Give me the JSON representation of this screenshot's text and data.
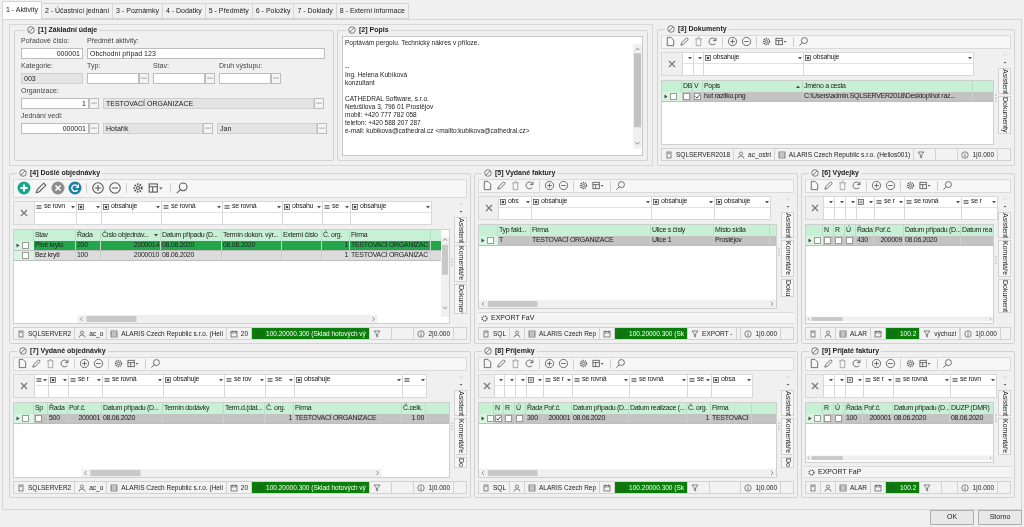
{
  "tabs": [
    {
      "label": "1 - Aktivity",
      "selected": true
    },
    {
      "label": "2 - Účastnící jednání",
      "selected": false
    },
    {
      "label": "3 - Poznámky",
      "selected": false
    },
    {
      "label": "4 - Dodatky",
      "selected": false
    },
    {
      "label": "5 - Předměty",
      "selected": false
    },
    {
      "label": "6 - Položky",
      "selected": false
    },
    {
      "label": "7 - Doklady",
      "selected": false
    },
    {
      "label": "8 - Externí informace",
      "selected": false
    }
  ],
  "basic": {
    "title": "[1] Základní údaje",
    "fields": [
      {
        "label": "Pořadové číslo:",
        "value": "000001",
        "kind": "number"
      },
      {
        "label": "Předmět aktivity:",
        "value": "Obchodní případ 123",
        "kind": "text"
      },
      {
        "label": "Kategorie:",
        "value": "003",
        "kind": "readonly"
      },
      {
        "label": "Typ:",
        "kind": "lookup"
      },
      {
        "label": "Stav:",
        "kind": "lookup"
      },
      {
        "label": "Druh výstupu:",
        "kind": "lookup"
      },
      {
        "label": "Organizace:",
        "value": "1",
        "kind": "number_lookup"
      },
      {
        "value": "TESTOVACÍ ORGANIZACE",
        "kind": "readonly_lookup"
      },
      {
        "label": "Jednání vedl:",
        "value": "000001",
        "kind": "number_lookup"
      },
      {
        "value": "Hotařík",
        "kind": "readonly_lookup"
      },
      {
        "value": "Jan",
        "kind": "readonly_lookup"
      }
    ]
  },
  "description": {
    "title": "[2] Popis",
    "text": "Poptávám pergolu. Technický nákres v příloze.\n\n\n--\nIng. Helena Kubíková\nkonzultant\n\nCATHEDRAL Software, s.r.o.\nNetušilova 3, 796 01 Prostějov\nmobil: +420 777 782 058\ntelefon: +420 588 207 287\ne-mail: kubikova@cathedral.cz <mailto:kubikova@cathedral.cz>"
  },
  "grids": [
    {
      "title": "[3] Dokumenty",
      "columns": [
        {
          "label": "DB",
          "kind": "plain",
          "filter": {
            "kind": "blank"
          }
        },
        {
          "label": "V",
          "kind": "plain",
          "filter": {
            "kind": "blank"
          }
        },
        {
          "label": "Popis",
          "kind": "sort_asc",
          "filter": {
            "kind": "square",
            "op": "obsahuje"
          }
        },
        {
          "label": "Jméno a cesta",
          "kind": "plain",
          "filter": {
            "kind": "square",
            "op": "obsahuje"
          }
        }
      ],
      "rows": [
        {
          "selected": true,
          "checked": false,
          "cells": [
            {
              "checked": false
            },
            {
              "checked": true
            },
            "hot razitko.png",
            "C:\\Users\\admin.SQLSERVER2018\\Desktop\\hot raz..."
          ]
        }
      ],
      "side_tabs": [
        "Asistent",
        "Dokumenty"
      ],
      "status": [
        {
          "kind": "server",
          "text": "SQLSERVER2018"
        },
        {
          "kind": "user",
          "text": "ac_ostri"
        },
        {
          "kind": "company",
          "text": "ALARIS Czech Republic s.r.o. (Helios001)"
        },
        {
          "kind": "filter"
        },
        {
          "kind": "info",
          "text": "1|0.000"
        }
      ]
    },
    {
      "title": "[4] Došlé objednávky",
      "columns": [
        {
          "label": "Stav",
          "kind": "plain",
          "filter": {
            "kind": "equals",
            "op": "se rovn"
          }
        },
        {
          "label": "Řada",
          "kind": "plain",
          "filter": {
            "kind": "square"
          }
        },
        {
          "label": "Číslo objednáv...",
          "kind": "sort_desc",
          "filter": {
            "kind": "square",
            "op": "obsahuje"
          }
        },
        {
          "label": "Datum případu (D...",
          "kind": "plain",
          "filter": {
            "kind": "equals",
            "op": "se rovná"
          }
        },
        {
          "label": "Termín dokon. výr...",
          "kind": "plain",
          "filter": {
            "kind": "equals",
            "op": "se rovná"
          }
        },
        {
          "label": "Externí číslo",
          "kind": "plain",
          "filter": {
            "kind": "square",
            "op": "obsahu"
          }
        },
        {
          "label": "Č. org.",
          "kind": "plain",
          "filter": {
            "kind": "equals",
            "op": "se"
          }
        },
        {
          "label": "Firma",
          "kind": "plain",
          "filter": {
            "kind": "square",
            "op": "obsahuje"
          }
        }
      ],
      "rows": [
        {
          "selected": true,
          "checked": false,
          "color": "#22a54b",
          "cells": [
            "Plné kryto",
            "200",
            "2000014",
            "08.06.2020",
            "08.06.2020",
            null,
            "1",
            "TESTOVACÍ ORGANIZAC"
          ]
        },
        {
          "selected": false,
          "checked": false,
          "color": "#dcdcdc",
          "cells": [
            "Bez krytí",
            "100",
            "2000010",
            "08.06.2020",
            null,
            null,
            "1",
            "TESTOVACÍ ORGANIZAC"
          ]
        }
      ],
      "side_tabs": [
        "Asistent",
        "Komentáře",
        "Dokumer"
      ],
      "status": [
        {
          "kind": "server",
          "text": "SQLSERVER2"
        },
        {
          "kind": "user",
          "text": "ac_o"
        },
        {
          "kind": "company",
          "text": "ALARIS Czech Republic s.r.o. (Heli"
        },
        {
          "kind": "calendar",
          "text": "20"
        },
        {
          "kind": "warehouse",
          "text": "100.20000.300 (Sklad hotových vý"
        },
        {
          "kind": "filter"
        },
        {
          "kind": "info",
          "text": "2|0.000"
        }
      ]
    },
    {
      "title": "[5] Vydané faktury",
      "columns": [
        {
          "label": "Typ fakt...",
          "kind": "plain",
          "filter": {
            "kind": "square",
            "op": "obs"
          }
        },
        {
          "label": "Firma",
          "kind": "plain",
          "filter": {
            "kind": "square",
            "op": "obsahuje"
          }
        },
        {
          "label": "Ulice s čísly",
          "kind": "plain",
          "filter": {
            "kind": "square",
            "op": "obsahuje"
          }
        },
        {
          "label": "Místo sídla",
          "kind": "plain",
          "filter": {
            "kind": "square",
            "op": "obsahuje"
          }
        }
      ],
      "rows": [
        {
          "selected": true,
          "checked": false,
          "cells": [
            "T",
            "TESTOVACÍ ORGANIZACE",
            "Ulice 1",
            "Prostějov"
          ]
        }
      ],
      "side_tabs": [
        "Asistent",
        "Komentáře",
        "Doku"
      ],
      "action": "EXPORT FaV",
      "status": [
        {
          "kind": "server",
          "text": "SQL"
        },
        {
          "kind": "user"
        },
        {
          "kind": "company",
          "text": "ALARIS Czech Rep"
        },
        {
          "kind": "calendar"
        },
        {
          "kind": "warehouse",
          "text": "100.20000.300 (Sk"
        },
        {
          "kind": "filter",
          "text": "EXPORT -"
        },
        {
          "kind": "info",
          "text": "1|0.000"
        }
      ]
    },
    {
      "title": "[6] Výdejky",
      "columns": [
        {
          "label": "N",
          "kind": "plain",
          "filter": {
            "kind": "blank"
          }
        },
        {
          "label": "R",
          "kind": "plain",
          "filter": {
            "kind": "blank"
          }
        },
        {
          "label": "Ú",
          "kind": "plain",
          "filter": {
            "kind": "blank"
          }
        },
        {
          "label": "Řada",
          "kind": "plain",
          "filter": {
            "kind": "square_equals"
          }
        },
        {
          "label": "Poř.č.",
          "kind": "plain",
          "filter": {
            "kind": "equals",
            "op": "se r"
          }
        },
        {
          "label": "Datum případu (D...",
          "kind": "plain",
          "filter": {
            "kind": "equals",
            "op": "se rovná"
          }
        },
        {
          "label": "Datum rea",
          "kind": "plain",
          "filter": {
            "kind": "equals",
            "op": "se r"
          }
        }
      ],
      "rows": [
        {
          "selected": true,
          "checked": false,
          "cells": [
            {
              "checked": false
            },
            {
              "checked": false
            },
            {
              "checked": false
            },
            "430",
            "200009",
            "08.06.2020",
            null
          ]
        }
      ],
      "side_tabs": [
        "Asistent",
        "Komentáře",
        "Dokument"
      ],
      "status": [
        {
          "kind": "server"
        },
        {
          "kind": "user"
        },
        {
          "kind": "company",
          "text": "ALAR"
        },
        {
          "kind": "calendar"
        },
        {
          "kind": "warehouse",
          "text": "100.2"
        },
        {
          "kind": "filter",
          "text": "výchozí"
        },
        {
          "kind": "info",
          "text": "1|0.000"
        }
      ]
    },
    {
      "title": "[7] Vydané objednávky",
      "columns": [
        {
          "label": "Sp",
          "kind": "plain",
          "filter": {
            "kind": "equals"
          }
        },
        {
          "label": "Řada",
          "kind": "plain",
          "filter": {
            "kind": "square"
          }
        },
        {
          "label": "Poř.č.",
          "kind": "plain",
          "filter": {
            "kind": "equals",
            "op": "se r"
          }
        },
        {
          "label": "Datum případu (D...",
          "kind": "plain",
          "filter": {
            "kind": "equals",
            "op": "se rovná"
          }
        },
        {
          "label": "Termín dodávky",
          "kind": "plain",
          "filter": {
            "kind": "square",
            "op": "obsahuje"
          }
        },
        {
          "label": "Term.d.(dat...",
          "kind": "plain",
          "filter": {
            "kind": "equals",
            "op": "se rov"
          }
        },
        {
          "label": "Č. org.",
          "kind": "plain",
          "filter": {
            "kind": "equals",
            "op": "se"
          }
        },
        {
          "label": "Firma",
          "kind": "plain",
          "filter": {
            "kind": "square",
            "op": "obsahuje"
          }
        },
        {
          "label": "Č.celk.",
          "kind": "plain",
          "filter": {
            "kind": "equals"
          }
        }
      ],
      "rows": [
        {
          "selected": true,
          "checked": false,
          "cells": [
            {
              "checked": false
            },
            "500",
            "200001",
            "08.06.2020",
            null,
            null,
            "1",
            "TESTOVACÍ ORGANIZACE",
            "1 00"
          ]
        }
      ],
      "side_tabs": [
        "Asistent",
        "Komentáře",
        "Do"
      ],
      "status": [
        {
          "kind": "server",
          "text": "SQLSERVER2"
        },
        {
          "kind": "user",
          "text": "ac_o"
        },
        {
          "kind": "company",
          "text": "ALARIS Czech Republic s.r.o. (Heli"
        },
        {
          "kind": "calendar",
          "text": "20"
        },
        {
          "kind": "warehouse",
          "text": "100.20000.300 (Sklad hotových vý"
        },
        {
          "kind": "filter"
        },
        {
          "kind": "info",
          "text": "1|0.000"
        }
      ]
    },
    {
      "title": "[8] Příjemky",
      "columns": [
        {
          "label": "N",
          "kind": "plain",
          "filter": {
            "kind": "blank"
          }
        },
        {
          "label": "R",
          "kind": "plain",
          "filter": {
            "kind": "blank"
          }
        },
        {
          "label": "Ú",
          "kind": "plain",
          "filter": {
            "kind": "blank"
          }
        },
        {
          "label": "Řada",
          "kind": "plain",
          "filter": {
            "kind": "square_equals"
          }
        },
        {
          "label": "Poř.č.",
          "kind": "plain",
          "filter": {
            "kind": "equals",
            "op": "se r"
          }
        },
        {
          "label": "Datum případu (D...",
          "kind": "plain",
          "filter": {
            "kind": "equals",
            "op": "se rovná"
          }
        },
        {
          "label": "Datum realizace (...",
          "kind": "plain",
          "filter": {
            "kind": "equals",
            "op": "se rovná"
          }
        },
        {
          "label": "Č. org.",
          "kind": "plain",
          "filter": {
            "kind": "equals",
            "op": "se"
          }
        },
        {
          "label": "Firma",
          "kind": "plain",
          "filter": {
            "kind": "square",
            "op": "obsa"
          }
        }
      ],
      "rows": [
        {
          "selected": true,
          "checked": false,
          "cells": [
            {
              "checked": true
            },
            {
              "checked": false
            },
            {
              "checked": false
            },
            "300",
            "200001",
            "08.06.2020",
            null,
            "1",
            "TESTOVACÍ"
          ]
        }
      ],
      "side_tabs": [
        "Asistent",
        "Komentáře",
        "Do"
      ],
      "status": [
        {
          "kind": "server",
          "text": "SQL"
        },
        {
          "kind": "user"
        },
        {
          "kind": "company",
          "text": "ALARIS Czech Rep"
        },
        {
          "kind": "calendar"
        },
        {
          "kind": "warehouse",
          "text": "100.20000.300 (Sk"
        },
        {
          "kind": "filter"
        },
        {
          "kind": "info",
          "text": "1|0.000"
        }
      ]
    },
    {
      "title": "[9] Přijaté faktury",
      "columns": [
        {
          "label": "R",
          "kind": "plain",
          "filter": {
            "kind": "blank"
          }
        },
        {
          "label": "Ú",
          "kind": "plain",
          "filter": {
            "kind": "blank"
          }
        },
        {
          "label": "Řada",
          "kind": "plain",
          "filter": {
            "kind": "square_equals"
          }
        },
        {
          "label": "Poř.č.",
          "kind": "plain",
          "filter": {
            "kind": "equals",
            "op": "se r"
          }
        },
        {
          "label": "Datum případu (D...",
          "kind": "plain",
          "filter": {
            "kind": "equals",
            "op": "se rovná"
          }
        },
        {
          "label": "DUZP (DMR)",
          "kind": "plain",
          "filter": {
            "kind": "equals",
            "op": "se rovn"
          }
        }
      ],
      "rows": [
        {
          "selected": true,
          "checked": false,
          "cells": [
            {
              "checked": false
            },
            {
              "checked": false
            },
            "100",
            "200001",
            "08.06.2020",
            "08.06.2020"
          ]
        }
      ],
      "side_tabs": [
        "Asistent",
        "Komentáře"
      ],
      "action": "EXPORT FaP",
      "status": [
        {
          "kind": "server"
        },
        {
          "kind": "user"
        },
        {
          "kind": "company",
          "text": "ALAR"
        },
        {
          "kind": "calendar"
        },
        {
          "kind": "warehouse",
          "text": "100.2"
        },
        {
          "kind": "filter"
        },
        {
          "kind": "info",
          "text": "1|0.000"
        }
      ]
    }
  ],
  "buttons": [
    "OK",
    "Storno"
  ]
}
